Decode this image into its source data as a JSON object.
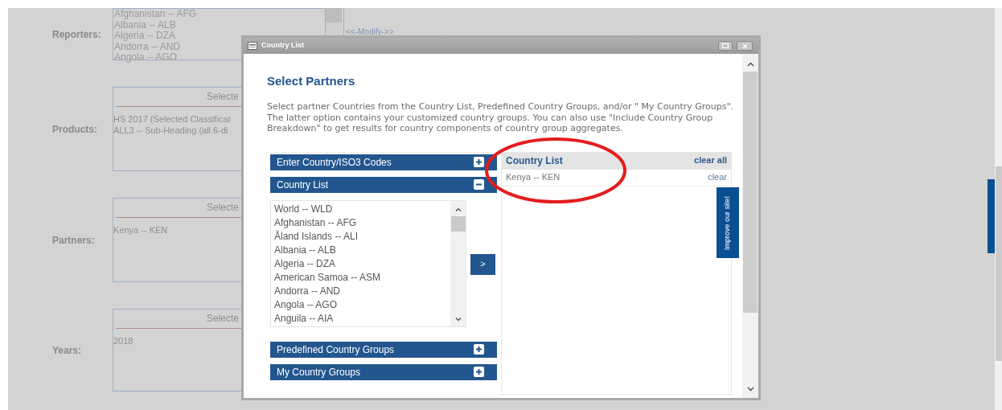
{
  "form": {
    "modify_link": "<<-Modify->>",
    "rows": [
      {
        "label": "Reporters:",
        "kind": "list",
        "items": [
          "Afghanistan -- AFG",
          "Albania -- ALB",
          "Algeria -- DZA",
          "Andorra -- AND",
          "Angola -- AGO"
        ]
      },
      {
        "label": "Products:",
        "kind": "selected",
        "header": "Selecte",
        "items": [
          "HS 2017 (Selected Classificat",
          "ALL3 -- Sub-Heading (all 6-di"
        ]
      },
      {
        "label": "Partners:",
        "kind": "selected",
        "header": "Selecte",
        "items": [
          "Kenya -- KEN"
        ]
      },
      {
        "label": "Years:",
        "kind": "selected",
        "header": "Selecte",
        "items": [
          "2018"
        ]
      }
    ]
  },
  "modal": {
    "title": "Country List",
    "heading": "Select Partners",
    "description": "Select partner Countries from the Country List, Predefined Country Groups, and/or \" My Country Groups\". The latter option contains your customized country groups. You can also use \"Include Country Group Breakdown\" to get results for country components of country group aggregates.",
    "sections": [
      {
        "title": "Enter Country/ISO3 Codes",
        "expanded": false
      },
      {
        "title": "Country List",
        "expanded": true,
        "items": [
          "World -- WLD",
          "Afghanistan -- AFG",
          "Åland Islands -- ALI",
          "Albania -- ALB",
          "Algeria -- DZA",
          "American Samoa -- ASM",
          "Andorra -- AND",
          "Angola -- AGO",
          "Anguila -- AIA"
        ]
      },
      {
        "title": "Predefined Country Groups",
        "expanded": false
      },
      {
        "title": "My Country Groups",
        "expanded": false
      }
    ],
    "add_button": ">",
    "selected_panel": {
      "title": "Country List",
      "clear_all": "clear all",
      "items": [
        {
          "name": "Kenya -- KEN",
          "action": "clear"
        }
      ]
    },
    "feedback_tab": "Improve our site!"
  }
}
